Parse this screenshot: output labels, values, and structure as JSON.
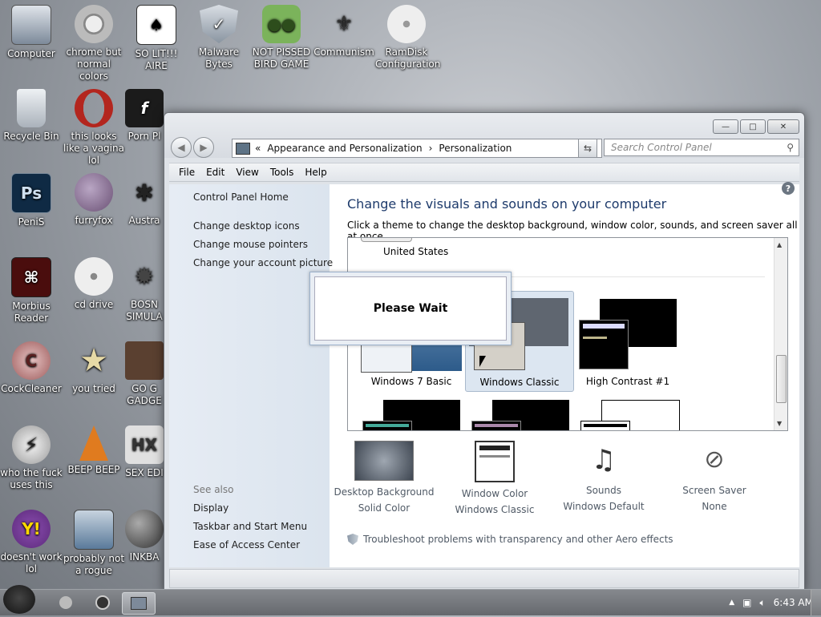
{
  "desktop": {
    "icons": [
      {
        "label": "Computer",
        "color": "#7d8a9a"
      },
      {
        "label": "chrome but normal colors",
        "color": "#d0d0d0"
      },
      {
        "label": "SO LIT!!! AIRE",
        "color": "#ffffff"
      },
      {
        "label": "Malware Bytes",
        "color": "#9aa5b1"
      },
      {
        "label": "NOT PISSED BIRD GAME",
        "color": "#7bb35b"
      },
      {
        "label": "Communism",
        "color": "#444444"
      },
      {
        "label": "RamDisk Configuration",
        "color": "#d8d8d8"
      },
      {
        "label": "Recycle Bin",
        "color": "#c8cdd3"
      },
      {
        "label": "this looks like a vagina lol",
        "color": "#b3261e"
      },
      {
        "label": "Porn Pl",
        "color": "#1b1b1b"
      },
      {
        "label": "PeniS",
        "color": "#0f2a44"
      },
      {
        "label": "furryfox",
        "color": "#7e6a85"
      },
      {
        "label": "Austra",
        "color": "#333333"
      },
      {
        "label": "Morbius Reader",
        "color": "#4a0d0d"
      },
      {
        "label": "cd drive",
        "color": "#dedede"
      },
      {
        "label": "BOSN SIMULA",
        "color": "#444444"
      },
      {
        "label": "CockCleaner",
        "color": "#9d5b5b"
      },
      {
        "label": "you tried",
        "color": "#d7c58b"
      },
      {
        "label": "GO G GADGE",
        "color": "#5a4030"
      },
      {
        "label": "who the fuck uses this",
        "color": "#4d4d4d"
      },
      {
        "label": "BEEP BEEP",
        "color": "#e07b1f"
      },
      {
        "label": "SEX EDI",
        "color": "#cccccc"
      },
      {
        "label": "doesn't work lol",
        "color": "#5c2a7a"
      },
      {
        "label": "probably not a rogue",
        "color": "#5a7a9a"
      },
      {
        "label": "INKBA",
        "color": "#333333"
      }
    ]
  },
  "window": {
    "caption": {
      "minimize": "—",
      "maximize": "□",
      "close": "✕"
    },
    "address": {
      "prefix": "«",
      "crumb1": "Appearance and Personalization",
      "sep": "›",
      "crumb2": "Personalization",
      "dropdown": "▾"
    },
    "search_placeholder": "Search Control Panel",
    "menu": [
      "File",
      "Edit",
      "View",
      "Tools",
      "Help"
    ],
    "left_links": {
      "home": "Control Panel Home",
      "desktop_icons": "Change desktop icons",
      "mouse_pointers": "Change mouse pointers",
      "account_picture": "Change your account picture",
      "see_also": "See also",
      "display": "Display",
      "taskbar": "Taskbar and Start Menu",
      "ease": "Ease of Access Center"
    },
    "heading": "Change the visuals and sounds on your computer",
    "subheading": "Click a theme to change the desktop background, window color, sounds, and screen saver all at once.",
    "themes": {
      "region_label": "United States",
      "items": [
        "Windows 7 Basic",
        "Windows Classic",
        "High Contrast #1"
      ],
      "selected": "Windows Classic"
    },
    "please_wait": "Please Wait",
    "bottom": [
      {
        "title": "Desktop Background",
        "value": "Solid Color"
      },
      {
        "title": "Window Color",
        "value": "Windows Classic"
      },
      {
        "title": "Sounds",
        "value": "Windows Default"
      },
      {
        "title": "Screen Saver",
        "value": "None"
      }
    ],
    "troubleshoot": "Troubleshoot problems with transparency and other Aero effects"
  },
  "taskbar": {
    "clock": "6:43 AM",
    "tray_up": "▲"
  }
}
